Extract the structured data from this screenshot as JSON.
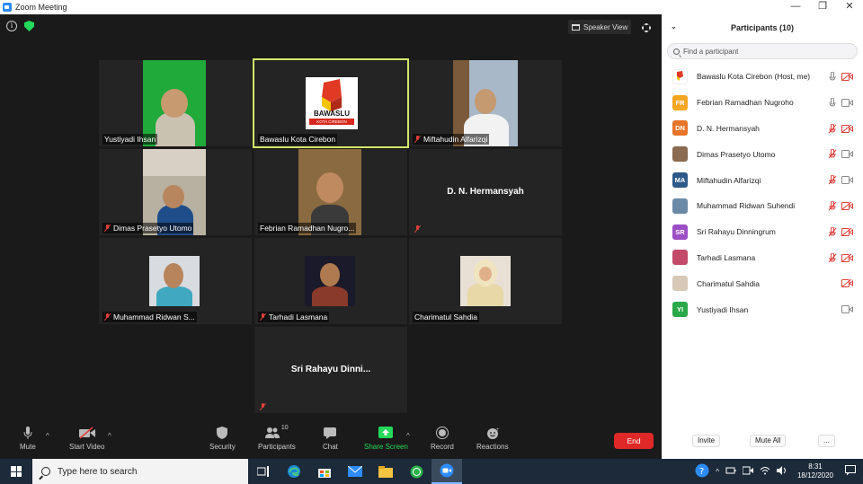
{
  "window": {
    "title": "Zoom Meeting",
    "controls": [
      "minimize",
      "maximize",
      "close"
    ]
  },
  "video_area": {
    "view_button": "Speaker View",
    "tiles": [
      {
        "name": "Yustiyadi Ihsan",
        "muted": false,
        "has_video": true
      },
      {
        "name": "Bawaslu Kota Cirebon",
        "muted": false,
        "has_video": true,
        "active_speaker": true,
        "logo_text": "BAWASLU",
        "logo_sub": "KOTA CIREBON"
      },
      {
        "name": "Miftahudin Alfarizqi",
        "muted": true,
        "has_video": true
      },
      {
        "name": "Dimas Prasetyo Utomo",
        "muted": true,
        "has_video": true
      },
      {
        "name": "Febrian Ramadhan Nugro...",
        "muted": false,
        "has_video": true
      },
      {
        "name": "D. N. Hermansyah",
        "muted": true,
        "has_video": false
      },
      {
        "name": "Muhammad Ridwan S...",
        "muted": true,
        "has_video": true
      },
      {
        "name": "Tarhadi Lasmana",
        "muted": true,
        "has_video": true
      },
      {
        "name": "Charimatul Sahdia",
        "muted": false,
        "has_video": true
      },
      {
        "name": "Sri Rahayu Dinni...",
        "muted": true,
        "has_video": false
      }
    ]
  },
  "toolbar": {
    "mute": "Mute",
    "start_video": "Start Video",
    "security": "Security",
    "participants": "Participants",
    "participants_count": "10",
    "chat": "Chat",
    "share_screen": "Share Screen",
    "record": "Record",
    "reactions": "Reactions",
    "end": "End"
  },
  "participants_panel": {
    "title": "Participants (10)",
    "search_placeholder": "Find a participant",
    "participants": [
      {
        "name": "Bawaslu Kota Cirebon (Host, me)",
        "initials": "",
        "color": "#ffffff",
        "mic": "on",
        "camera": "off"
      },
      {
        "name": "Febrian Ramadhan Nugroho",
        "initials": "FR",
        "color": "#f5a623",
        "mic": "on",
        "camera": "on"
      },
      {
        "name": "D. N. Hermansyah",
        "initials": "DN",
        "color": "#e8742b",
        "mic": "off",
        "camera": "off"
      },
      {
        "name": "Dimas Prasetyo Utomo",
        "initials": "",
        "color": "#8a6a50",
        "mic": "off",
        "camera": "on"
      },
      {
        "name": "Miftahudin Alfarizqi",
        "initials": "MA",
        "color": "#2d5a8a",
        "mic": "off",
        "camera": "on"
      },
      {
        "name": "Muhammad Ridwan Suhendi",
        "initials": "",
        "color": "#6a8aa8",
        "mic": "off",
        "camera": "off"
      },
      {
        "name": "Sri Rahayu Dinningrum",
        "initials": "SR",
        "color": "#9b4fc4",
        "mic": "off",
        "camera": "off"
      },
      {
        "name": "Tarhadi Lasmana",
        "initials": "",
        "color": "#c44a6a",
        "mic": "off",
        "camera": "off"
      },
      {
        "name": "Charimatul Sahdia",
        "initials": "",
        "color": "#d8c8b8",
        "mic": "none",
        "camera": "off"
      },
      {
        "name": "Yustiyadi Ihsan",
        "initials": "YI",
        "color": "#2aa84a",
        "mic": "none",
        "camera": "on"
      }
    ],
    "invite": "Invite",
    "mute_all": "Mute All",
    "more": "..."
  },
  "taskbar": {
    "search_placeholder": "Type here to search",
    "time": "8:31",
    "date": "18/12/2020"
  }
}
